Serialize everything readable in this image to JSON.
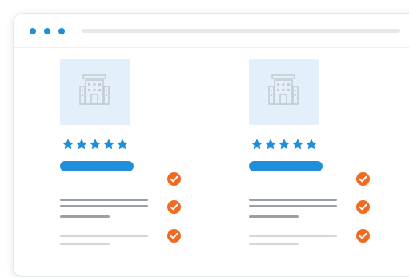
{
  "window": {
    "dot_color": "#1f8fdb"
  },
  "theme": {
    "accent": "#1f8fdb",
    "check": "#f26a21",
    "thumb_bg": "#e3f0fb",
    "icon_stroke": "#c5ccd3"
  },
  "cards": [
    {
      "rating": 5,
      "checks": 3,
      "icon": "hotel-building-icon"
    },
    {
      "rating": 5,
      "checks": 3,
      "icon": "hotel-building-icon"
    }
  ]
}
